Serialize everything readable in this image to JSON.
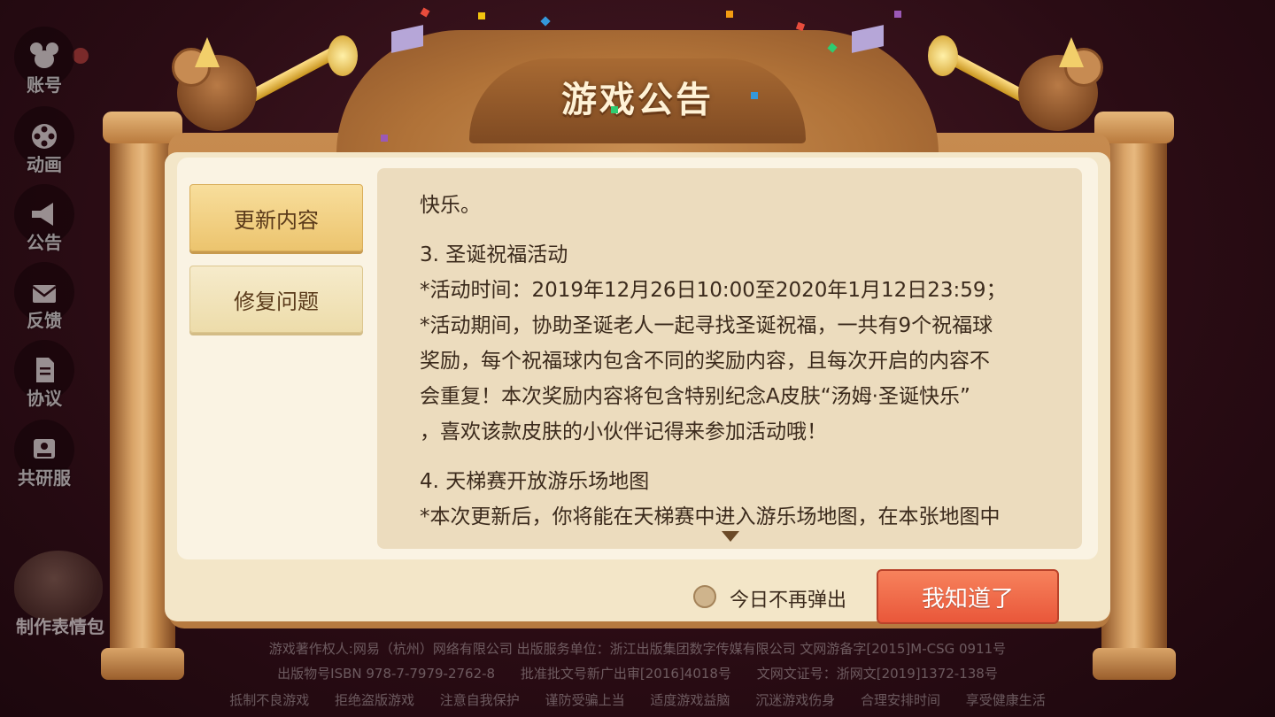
{
  "sidebar": {
    "items": [
      {
        "label": "账号",
        "icon": "mouse-head-icon"
      },
      {
        "label": "动画",
        "icon": "film-reel-icon"
      },
      {
        "label": "公告",
        "icon": "megaphone-icon"
      },
      {
        "label": "反馈",
        "icon": "mail-icon"
      },
      {
        "label": "协议",
        "icon": "document-icon"
      },
      {
        "label": "共研服",
        "icon": "lab-icon"
      }
    ],
    "meme_button": "制作表情包"
  },
  "dialog": {
    "title": "游戏公告",
    "tabs": [
      {
        "label": "更新内容",
        "active": true
      },
      {
        "label": "修复问题",
        "active": false
      }
    ],
    "content": {
      "lines": [
        "快乐。",
        "3. 圣诞祝福活动",
        "*活动时间：2019年12月26日10:00至2020年1月12日23:59；",
        "*活动期间，协助圣诞老人一起寻找圣诞祝福，一共有9个祝福球",
        "奖励，每个祝福球内包含不同的奖励内容，且每次开启的内容不",
        "会重复！本次奖励内容将包含特别纪念A皮肤“汤姆·圣诞快乐”",
        "，喜欢该款皮肤的小伙伴记得来参加活动哦！",
        "4. 天梯赛开放游乐场地图",
        "*本次更新后，你将能在天梯赛中进入游乐场地图，在本张地图中"
      ]
    },
    "dont_show_today_label": "今日不再弹出",
    "ok_button": "我知道了"
  },
  "footer": {
    "line1": "游戏著作权人:网易（杭州）网络有限公司 出版服务单位：浙江出版集团数字传媒有限公司 文网游备字[2015]M-CSG 0911号",
    "line2_items": [
      "出版物号ISBN 978-7-7979-2762-8",
      "批准批文号新广出审[2016]4018号",
      "文网文证号：浙网文[2019]1372-138号"
    ],
    "line3_items": [
      "抵制不良游戏",
      "拒绝盗版游戏",
      "注意自我保护",
      "谨防受骗上当",
      "适度游戏益脑",
      "沉迷游戏伤身",
      "合理安排时间",
      "享受健康生活"
    ]
  },
  "colors": {
    "accent_orange": "#ee5f3f",
    "tab_gold": "#f2cf7e",
    "wood": "#c68b4f",
    "paper": "#f3e6c8",
    "background": "#2a0c14"
  }
}
